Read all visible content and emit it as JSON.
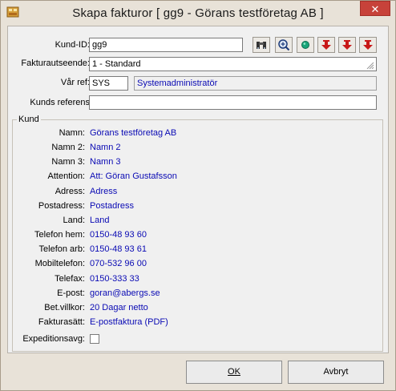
{
  "window": {
    "title": "Skapa fakturor [ gg9 - Görans testföretag AB ]",
    "close_label": "✕"
  },
  "form": {
    "kund_id_label": "Kund-ID:",
    "kund_id_value": "gg9",
    "fakturautseende_label": "Fakturautseende:",
    "fakturautseende_value": "1  - Standard",
    "var_ref_label": "Vår ref:",
    "var_ref_code": "SYS",
    "var_ref_name": "Systemadministratör",
    "kunds_referens_label": "Kunds referens",
    "kunds_referens_value": ""
  },
  "toolbar": {
    "icons": [
      "binoculars-icon",
      "zoom-in-icon",
      "green-circle-icon",
      "red-down-arrow-icon",
      "red-down-arrow-icon",
      "red-down-arrow-icon"
    ]
  },
  "kund": {
    "group_title": "Kund",
    "rows": [
      {
        "label": "Namn:",
        "value": "Görans testföretag AB"
      },
      {
        "label": "Namn 2:",
        "value": "Namn 2"
      },
      {
        "label": "Namn 3:",
        "value": "Namn 3"
      },
      {
        "label": "Attention:",
        "value": "Att: Göran Gustafsson"
      },
      {
        "label": "Adress:",
        "value": "Adress"
      },
      {
        "label": "Postadress:",
        "value": "Postadress"
      },
      {
        "label": "Land:",
        "value": "Land"
      },
      {
        "label": "Telefon hem:",
        "value": "0150-48 93 60"
      },
      {
        "label": "Telefon arb:",
        "value": "0150-48 93 61"
      },
      {
        "label": "Mobiltelefon:",
        "value": "070-532 96 00"
      },
      {
        "label": "Telefax:",
        "value": "0150-333 33"
      },
      {
        "label": "E-post:",
        "value": "goran@abergs.se"
      },
      {
        "label": "Bet.villkor:",
        "value": "20 Dagar netto"
      },
      {
        "label": "Fakturasätt:",
        "value": "E-postfaktura (PDF)"
      }
    ],
    "expeditionsavg_label": "Expeditionsavg:"
  },
  "buttons": {
    "ok_label": "OK",
    "avbryt_label": "Avbryt"
  },
  "colors": {
    "value_text": "#0a0ab4",
    "close_button": "#c7423a"
  }
}
